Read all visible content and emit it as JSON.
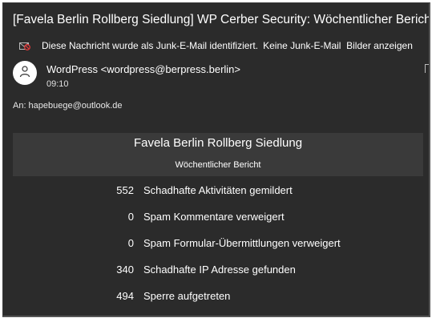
{
  "email": {
    "subject": "[Favela Berlin Rollberg Siedlung] WP Cerber Security: Wöchentlicher Bericht",
    "junk_notice": "Diese Nachricht wurde als Junk-E-Mail identifiziert.",
    "not_junk_label": "Keine Junk-E-Mail",
    "show_images_label": "Bilder anzeigen",
    "sender": "WordPress <wordpress@berpress.berlin>",
    "time": "09:10",
    "to_label": "An:",
    "to_address": "hapebuege@outlook.de"
  },
  "report": {
    "site_title": "Favela Berlin Rollberg Siedlung",
    "subtitle": "Wöchentlicher Bericht",
    "stats": [
      {
        "value": "552",
        "label": "Schadhafte Aktivitäten gemildert"
      },
      {
        "value": "0",
        "label": "Spam Kommentare verweigert"
      },
      {
        "value": "0",
        "label": "Spam Formular-Übermittlungen verweigert"
      },
      {
        "value": "340",
        "label": "Schadhafte IP Adresse gefunden"
      },
      {
        "value": "494",
        "label": "Sperre aufgetreten"
      }
    ]
  },
  "icons": {
    "junk": "junk-mail-icon",
    "avatar": "person-icon"
  },
  "colors": {
    "background": "#2b2b2b",
    "banner": "#3a3a3a",
    "text": "#ffffff",
    "junk_icon": "#e03a3a"
  }
}
